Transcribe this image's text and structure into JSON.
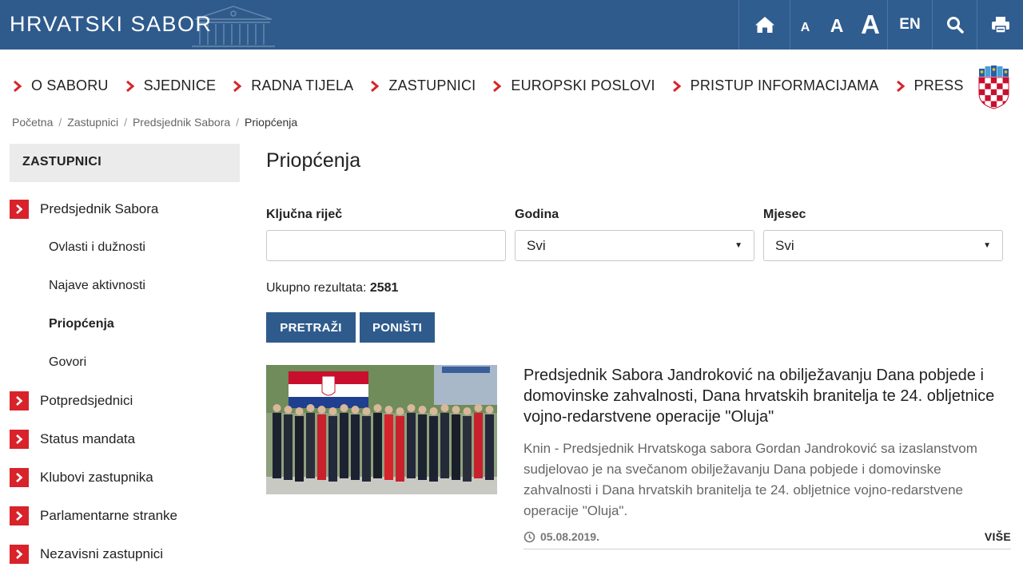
{
  "header": {
    "brand": "HRVATSKI SABOR",
    "font_small": "A",
    "font_medium": "A",
    "font_large": "A",
    "language": "EN",
    "color": "#2f5b8c"
  },
  "main_nav": [
    {
      "label": "O SABORU"
    },
    {
      "label": "SJEDNICE"
    },
    {
      "label": "RADNA TIJELA"
    },
    {
      "label": "ZASTUPNICI"
    },
    {
      "label": "EUROPSKI POSLOVI"
    },
    {
      "label": "PRISTUP INFORMACIJAMA"
    },
    {
      "label": "PRESS"
    }
  ],
  "breadcrumb": {
    "items": [
      "Početna",
      "Zastupnici",
      "Predsjednik Sabora"
    ],
    "current": "Priopćenja",
    "separator": "/"
  },
  "sidebar": {
    "title": "ZASTUPNICI",
    "main1": "Predsjednik Sabora",
    "subs": [
      "Ovlasti i dužnosti",
      "Najave aktivnosti",
      "Priopćenja",
      "Govori"
    ],
    "main_rest": [
      "Potpredsjednici",
      "Status mandata",
      "Klubovi zastupnika",
      "Parlamentarne stranke",
      "Nezavisni zastupnici"
    ],
    "accent": "#d8232a"
  },
  "page": {
    "title": "Priopćenja"
  },
  "filters": {
    "keyword_label": "Ključna riječ",
    "keyword_value": "",
    "year_label": "Godina",
    "year_value": "Svi",
    "month_label": "Mjesec",
    "month_value": "Svi"
  },
  "results": {
    "label": "Ukupno rezultata:",
    "count": "2581"
  },
  "buttons": {
    "search": "PRETRAŽI",
    "reset": "PONIŠTI"
  },
  "article": {
    "title": "Predsjednik Sabora Jandroković na obilježavanju Dana pobjede i domovinske zahvalnosti, Dana hrvatskih branitelja te 24. obljetnice vojno-redarstvene operacije \"Oluja\"",
    "lead": "Knin - Predsjednik Hrvatskoga sabora Gordan Jandroković sa izaslanstvom sudjelovao je na svečanom obilježavanju Dana pobjede i domovinske zahvalnosti i Dana hrvatskih branitelja te 24. obljetnice vojno-redarstvene operacije \"Oluja\".",
    "date": "05.08.2019.",
    "more": "VIŠE"
  }
}
